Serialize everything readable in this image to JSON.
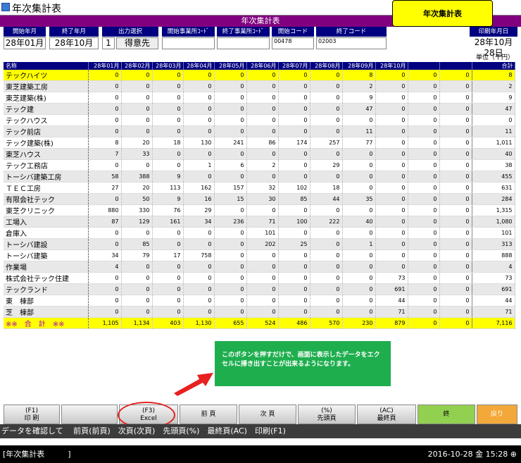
{
  "window": {
    "title": "年次集計表",
    "inner_title": "年次集計表"
  },
  "callout_top": "年次集計表",
  "params": {
    "labels": [
      "開始年月",
      "終了年月",
      "出力選択",
      "開始事業所ｺｰﾄﾞ",
      "終了事業所ｺｰﾄﾞ",
      "開始コード",
      "終了コード",
      "印刷年月日"
    ],
    "start_month": "28年01月",
    "end_month": "28年10月",
    "output_no": "1",
    "output_name": "得意先",
    "start_office": "",
    "end_office": "",
    "start_code": "00478",
    "end_code": "02003",
    "print_date": "28年10月28日"
  },
  "unit": "単位（千円）",
  "table": {
    "headers": [
      "名称",
      "28年01月",
      "28年02月",
      "28年03月",
      "28年04月",
      "28年05月",
      "28年06月",
      "28年07月",
      "28年08月",
      "28年09月",
      "28年10月",
      "",
      "",
      "合計"
    ],
    "rows": [
      [
        "テックハイツ",
        "0",
        "0",
        "0",
        "0",
        "0",
        "0",
        "0",
        "0",
        "8",
        "0",
        "0",
        "0",
        "8"
      ],
      [
        "東芝建築工房",
        "0",
        "0",
        "0",
        "0",
        "0",
        "0",
        "0",
        "0",
        "2",
        "0",
        "0",
        "0",
        "2"
      ],
      [
        "東芝建築(株)",
        "0",
        "0",
        "0",
        "0",
        "0",
        "0",
        "0",
        "0",
        "9",
        "0",
        "0",
        "0",
        "9"
      ],
      [
        "テック建",
        "0",
        "0",
        "0",
        "0",
        "0",
        "0",
        "0",
        "0",
        "47",
        "0",
        "0",
        "0",
        "47"
      ],
      [
        "テックハウス",
        "0",
        "0",
        "0",
        "0",
        "0",
        "0",
        "0",
        "0",
        "0",
        "0",
        "0",
        "0",
        "0"
      ],
      [
        "テック前店",
        "0",
        "0",
        "0",
        "0",
        "0",
        "0",
        "0",
        "0",
        "11",
        "0",
        "0",
        "0",
        "11"
      ],
      [
        "テック建築(株)",
        "8",
        "20",
        "18",
        "130",
        "241",
        "86",
        "174",
        "257",
        "77",
        "0",
        "0",
        "0",
        "1,011"
      ],
      [
        "東芝ハウス",
        "7",
        "33",
        "0",
        "0",
        "0",
        "0",
        "0",
        "0",
        "0",
        "0",
        "0",
        "0",
        "40"
      ],
      [
        "テック工務店",
        "0",
        "0",
        "0",
        "1",
        "6",
        "2",
        "0",
        "29",
        "0",
        "0",
        "0",
        "0",
        "38"
      ],
      [
        "トーシバ建築工房",
        "58",
        "388",
        "9",
        "0",
        "0",
        "0",
        "0",
        "0",
        "0",
        "0",
        "0",
        "0",
        "455"
      ],
      [
        "ＴＥＣ工房",
        "27",
        "20",
        "113",
        "162",
        "157",
        "32",
        "102",
        "18",
        "0",
        "0",
        "0",
        "0",
        "631"
      ],
      [
        "有限会社テック",
        "0",
        "50",
        "9",
        "16",
        "15",
        "30",
        "85",
        "44",
        "35",
        "0",
        "0",
        "0",
        "284"
      ],
      [
        "東芝クリニック",
        "880",
        "330",
        "76",
        "29",
        "0",
        "0",
        "0",
        "0",
        "0",
        "0",
        "0",
        "0",
        "1,315"
      ],
      [
        "工場入",
        "87",
        "129",
        "161",
        "34",
        "236",
        "71",
        "100",
        "222",
        "40",
        "0",
        "0",
        "0",
        "1,080"
      ],
      [
        "倉庫入",
        "0",
        "0",
        "0",
        "0",
        "0",
        "101",
        "0",
        "0",
        "0",
        "0",
        "0",
        "0",
        "101"
      ],
      [
        "トーシバ建設",
        "0",
        "85",
        "0",
        "0",
        "0",
        "202",
        "25",
        "0",
        "1",
        "0",
        "0",
        "0",
        "313"
      ],
      [
        "トーシバ建築",
        "34",
        "79",
        "17",
        "758",
        "0",
        "0",
        "0",
        "0",
        "0",
        "0",
        "0",
        "0",
        "888"
      ],
      [
        "作業場",
        "4",
        "0",
        "0",
        "0",
        "0",
        "0",
        "0",
        "0",
        "0",
        "0",
        "0",
        "0",
        "4"
      ],
      [
        "株式会社テック住建",
        "0",
        "0",
        "0",
        "0",
        "0",
        "0",
        "0",
        "0",
        "0",
        "73",
        "0",
        "0",
        "73"
      ],
      [
        "テックランド",
        "0",
        "0",
        "0",
        "0",
        "0",
        "0",
        "0",
        "0",
        "0",
        "691",
        "0",
        "0",
        "691"
      ],
      [
        "東　棟部",
        "0",
        "0",
        "0",
        "0",
        "0",
        "0",
        "0",
        "0",
        "0",
        "44",
        "0",
        "0",
        "44"
      ],
      [
        "芝　棟部",
        "0",
        "0",
        "0",
        "0",
        "0",
        "0",
        "0",
        "0",
        "0",
        "71",
        "0",
        "0",
        "71"
      ]
    ],
    "total": [
      "※※　合　計　※※",
      "1,105",
      "1,134",
      "403",
      "1,130",
      "655",
      "524",
      "486",
      "570",
      "230",
      "879",
      "0",
      "0",
      "7,116"
    ]
  },
  "note": "このボタンを押すだけで、画面に表示したデータをエクセルに掃き出すことが出来るようになります。",
  "fkeys": [
    {
      "top": "(F1)",
      "label": "印 刷"
    },
    {
      "top": "",
      "label": ""
    },
    {
      "top": "(F3)",
      "label": "Excel"
    },
    {
      "top": "",
      "label": "前 頁"
    },
    {
      "top": "",
      "label": "次 頁"
    },
    {
      "top": "(%)",
      "label": "先頭頁"
    },
    {
      "top": "(AC)",
      "label": "最終頁"
    },
    {
      "top": "",
      "label": "終"
    },
    {
      "top": "",
      "label": "戻り"
    }
  ],
  "status": "データを確認して　 前頁(前頁)　次頁(次頁)　先頭頁(%)　最終頁(AC)　印刷(F1)",
  "bottom": {
    "left": "[年次集計表　　　]",
    "right": "2016-10-28 金 15:28 ⊕"
  },
  "colors": {
    "header": "#000080",
    "highlight": "#ffff00",
    "note": "#1fae4e",
    "title": "#800080"
  }
}
